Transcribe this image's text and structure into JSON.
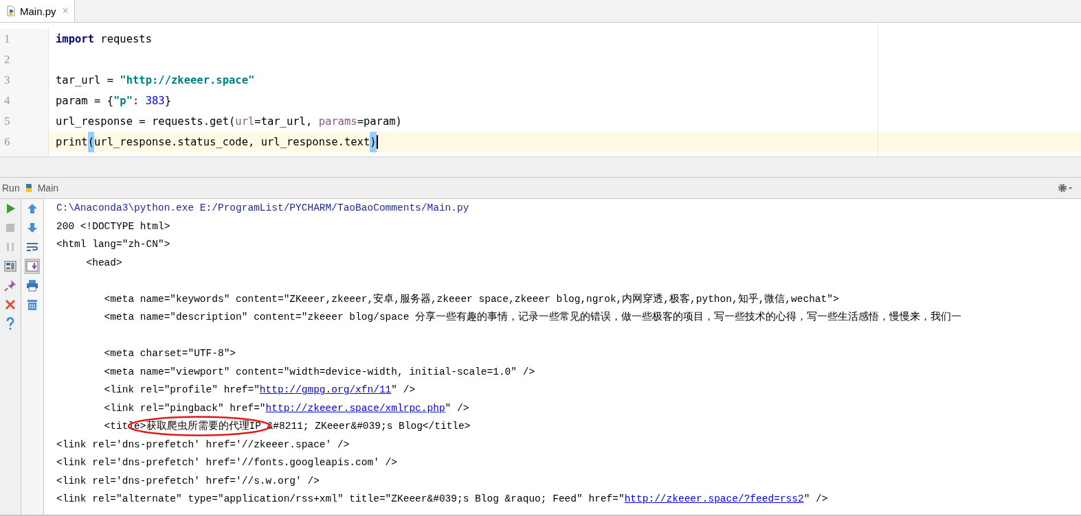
{
  "tabs": [
    {
      "label": "Main.py",
      "selected": true,
      "close": "×"
    }
  ],
  "editor": {
    "lines": [
      {
        "number": "1",
        "current": false,
        "tokens": [
          {
            "text": "import",
            "kind": "keyword"
          },
          {
            "text": " requests",
            "kind": "plain"
          }
        ]
      },
      {
        "number": "2",
        "current": false
      },
      {
        "number": "3",
        "current": false,
        "tokens": [
          {
            "text": "tar_url = ",
            "kind": "plain"
          },
          {
            "text": "\"http://zkeeer.space\"",
            "kind": "string"
          }
        ]
      },
      {
        "number": "4",
        "current": false,
        "tokens": [
          {
            "text": "param = {",
            "kind": "plain"
          },
          {
            "text": "\"p\"",
            "kind": "string"
          },
          {
            "text": ": ",
            "kind": "plain"
          },
          {
            "text": "383",
            "kind": "number"
          },
          {
            "text": "}",
            "kind": "plain"
          }
        ]
      },
      {
        "number": "5",
        "current": false,
        "tokens": [
          {
            "text": "url_response = requests.get(",
            "kind": "plain"
          },
          {
            "text": "url",
            "kind": "param"
          },
          {
            "text": "=tar_url, ",
            "kind": "plain"
          },
          {
            "text": "params",
            "kind": "param"
          },
          {
            "text": "=param)",
            "kind": "plain"
          }
        ]
      },
      {
        "number": "6",
        "current": true,
        "tokens": [
          {
            "text": "print",
            "kind": "plain"
          },
          {
            "text": "(",
            "kind": "match"
          },
          {
            "text": "url_response.status_code, url_response.text",
            "kind": "plain"
          },
          {
            "text": ")",
            "kind": "match"
          }
        ]
      }
    ]
  },
  "run_panel": {
    "label": "Run",
    "config": "Main"
  },
  "tools_left": [
    {
      "kind": "run",
      "disabled": false
    },
    {
      "kind": "stop",
      "disabled": true
    },
    {
      "kind": "pause",
      "disabled": true
    },
    {
      "kind": "layout",
      "disabled": false
    },
    {
      "kind": "pin",
      "disabled": false
    },
    {
      "kind": "close",
      "disabled": false
    },
    {
      "kind": "help",
      "disabled": false
    }
  ],
  "tools_right": [
    {
      "kind": "up",
      "on": false
    },
    {
      "kind": "down",
      "on": false
    },
    {
      "kind": "wrap",
      "on": false
    },
    {
      "kind": "scroll-end",
      "on": true
    },
    {
      "kind": "print",
      "on": false
    },
    {
      "kind": "trash",
      "on": false
    }
  ],
  "console": [
    {
      "circled": false,
      "segments": [
        {
          "text": "C:\\Anaconda3\\python.exe E:/ProgramList/PYCHARM/TaoBaoComments/Main.py",
          "kind": "system"
        }
      ]
    },
    {
      "circled": false,
      "segments": [
        {
          "text": "200 <!DOCTYPE html>",
          "kind": "text"
        }
      ]
    },
    {
      "circled": false,
      "segments": [
        {
          "text": "<html lang=\"zh-CN\">",
          "kind": "text"
        }
      ]
    },
    {
      "circled": false,
      "segments": [
        {
          "text": "     <head>",
          "kind": "text"
        }
      ]
    },
    {
      "circled": false
    },
    {
      "circled": false,
      "segments": [
        {
          "text": "        <meta name=\"keywords\" content=\"ZKeeer,zkeeer,安卓,服务器,zkeeer space,zkeeer blog,ngrok,内网穿透,极客,python,知乎,微信,wechat\">",
          "kind": "text"
        }
      ]
    },
    {
      "circled": false,
      "segments": [
        {
          "text": "        <meta name=\"description\" content=\"zkeeer blog/space 分享一些有趣的事情，记录一些常见的错误，做一些极客的项目，写一些技术的心得，写一些生活感悟，慢慢来，我们一",
          "kind": "text"
        }
      ]
    },
    {
      "circled": false
    },
    {
      "circled": false,
      "segments": [
        {
          "text": "        <meta charset=\"UTF-8\">",
          "kind": "text"
        }
      ]
    },
    {
      "circled": false,
      "segments": [
        {
          "text": "        <meta name=\"viewport\" content=\"width=device-width, initial-scale=1.0\" />",
          "kind": "text"
        }
      ]
    },
    {
      "circled": false,
      "segments": [
        {
          "text": "        <link rel=\"profile\" href=\"",
          "kind": "text"
        },
        {
          "text": "http://gmpg.org/xfn/11",
          "kind": "link"
        },
        {
          "text": "\" />",
          "kind": "text"
        }
      ]
    },
    {
      "circled": false,
      "segments": [
        {
          "text": "        <link rel=\"pingback\" href=\"",
          "kind": "text"
        },
        {
          "text": "http://zkeeer.space/xmlrpc.php",
          "kind": "link"
        },
        {
          "text": "\" />",
          "kind": "text"
        }
      ]
    },
    {
      "circled": true,
      "segments": [
        {
          "text": "        <title>获取爬虫所需要的代理IP &#8211; ZKeeer&#039;s Blog</title>",
          "kind": "text"
        }
      ]
    },
    {
      "circled": false,
      "segments": [
        {
          "text": "<link rel='dns-prefetch' href='//zkeeer.space' />",
          "kind": "text"
        }
      ]
    },
    {
      "circled": false,
      "segments": [
        {
          "text": "<link rel='dns-prefetch' href='//fonts.googleapis.com' />",
          "kind": "text"
        }
      ]
    },
    {
      "circled": false,
      "segments": [
        {
          "text": "<link rel='dns-prefetch' href='//s.w.org' />",
          "kind": "text"
        }
      ]
    },
    {
      "circled": false,
      "segments": [
        {
          "text": "<link rel=\"alternate\" type=\"application/rss+xml\" title=\"ZKeeer&#039;s Blog &raquo; Feed\" href=\"",
          "kind": "text"
        },
        {
          "text": "http://zkeeer.space/?feed=rss2",
          "kind": "link"
        },
        {
          "text": "\" />",
          "kind": "text"
        }
      ]
    }
  ]
}
